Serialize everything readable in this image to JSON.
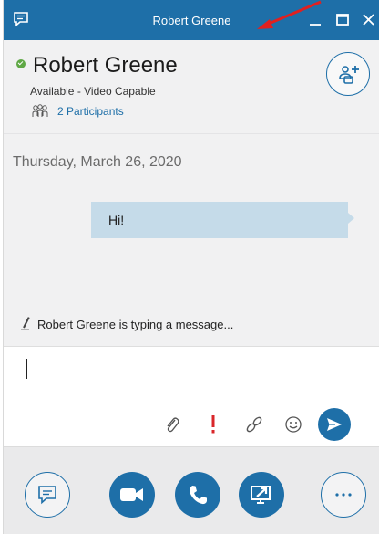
{
  "window": {
    "title": "Robert Greene",
    "accent_color": "#1e6fa8",
    "controls": [
      "minimize-icon",
      "maximize-icon",
      "close-icon"
    ]
  },
  "header": {
    "contact_name": "Robert Greene",
    "presence_color": "#5fa845",
    "status": "Available - Video Capable",
    "participants_label": "2 Participants",
    "add_people_icon": "add-people-icon"
  },
  "conversation": {
    "date": "Thursday, March 26, 2020",
    "messages": [
      {
        "text": "Hi!",
        "bubble_color": "#c5dbe9"
      }
    ],
    "typing_indicator": "Robert Greene is typing a message..."
  },
  "compose": {
    "value": "",
    "tools": [
      "paperclip-icon",
      "exclamation-icon",
      "link-icon",
      "emoji-icon",
      "send-icon"
    ],
    "priority_color": "#d9262a"
  },
  "bottom_bar": {
    "buttons": [
      "chat-icon",
      "video-icon",
      "phone-icon",
      "share-screen-icon",
      "more-options-icon"
    ]
  }
}
